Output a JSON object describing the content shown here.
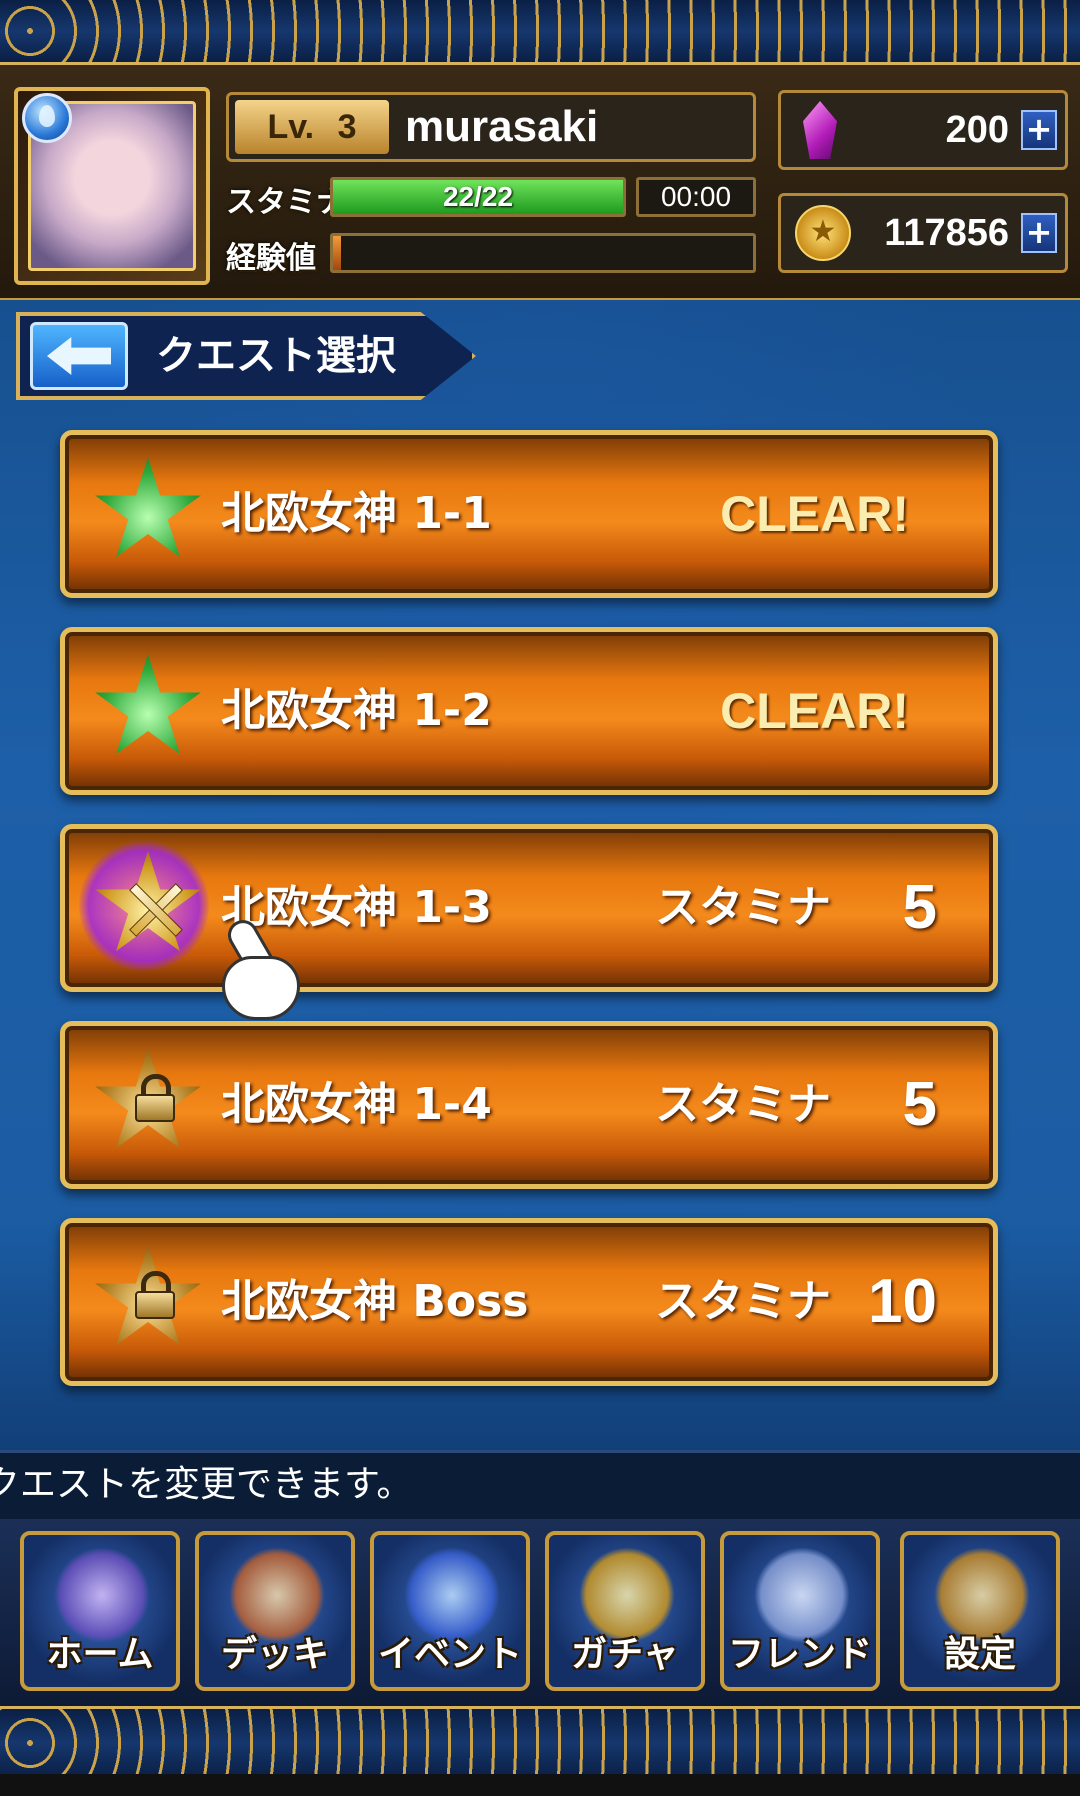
{
  "header": {
    "level_label": "Lv.",
    "level_value": "3",
    "player_name": "murasaki",
    "stamina_label": "スタミナ",
    "stamina_text": "22/22",
    "stamina_fraction": 1.0,
    "stamina_timer": "00:00",
    "exp_label": "経験値",
    "exp_fraction": 0.02,
    "gems": "200",
    "coins": "117856",
    "plus_label": "+",
    "coin_glyph": "★"
  },
  "nav": {
    "title": "クエスト選択"
  },
  "quests": [
    {
      "name": "北欧女神 1-1",
      "state": "cleared",
      "status": "CLEAR!"
    },
    {
      "name": "北欧女神 1-2",
      "state": "cleared",
      "status": "CLEAR!"
    },
    {
      "name": "北欧女神 1-3",
      "state": "available",
      "cost_label": "スタミナ",
      "cost_value": "5"
    },
    {
      "name": "北欧女神 1-4",
      "state": "locked",
      "cost_label": "スタミナ",
      "cost_value": "5"
    },
    {
      "name": "北欧女神 Boss",
      "state": "locked",
      "cost_label": "スタミナ",
      "cost_value": "10"
    }
  ],
  "message": "クエストを変更できます。",
  "bottom_nav": [
    {
      "label": "ホーム",
      "icon": "home-icon"
    },
    {
      "label": "デッキ",
      "icon": "deck-icon"
    },
    {
      "label": "イベント",
      "icon": "event-icon"
    },
    {
      "label": "ガチャ",
      "icon": "gacha-icon"
    },
    {
      "label": "フレンド",
      "icon": "friend-icon"
    },
    {
      "label": "設定",
      "icon": "settings-icon"
    }
  ],
  "colors": {
    "quest_orange": "#f48a1c",
    "gold_border": "#e5bd5a",
    "stamina_green": "#1e9a20",
    "background_blue": "#1d5fa8"
  }
}
